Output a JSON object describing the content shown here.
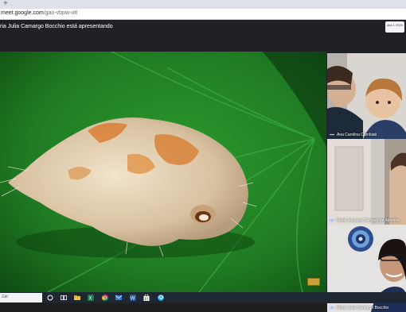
{
  "browser": {
    "new_tab_glyph": "+",
    "url_host": "meet.google.com",
    "url_path": "/gao-vbpw-ott"
  },
  "meet": {
    "presenting_text": "ria Julia Camargo Bocchio está apresentando",
    "clock_badge": "dez 1 2024"
  },
  "participants": [
    {
      "name": "Ana Carolina Cambiati",
      "icon": "more-options-icon"
    },
    {
      "name": "Maria Joseane Zamperi de Almeida",
      "icon": "mic-active-icon"
    },
    {
      "name": "Maria Julia Camargo Bocchio",
      "icon": "mic-active-icon"
    }
  ],
  "taskbar": {
    "search_placeholder": "zar",
    "icons": [
      "windows-start-icon",
      "task-view-icon",
      "file-explorer-icon",
      "excel-icon",
      "chrome-icon",
      "mail-icon",
      "word-icon",
      "store-icon",
      "edge-icon"
    ]
  },
  "colors": {
    "meet_background": "#202124",
    "taskbar": "#1f2733",
    "leaf_green": "#1f7a22"
  }
}
